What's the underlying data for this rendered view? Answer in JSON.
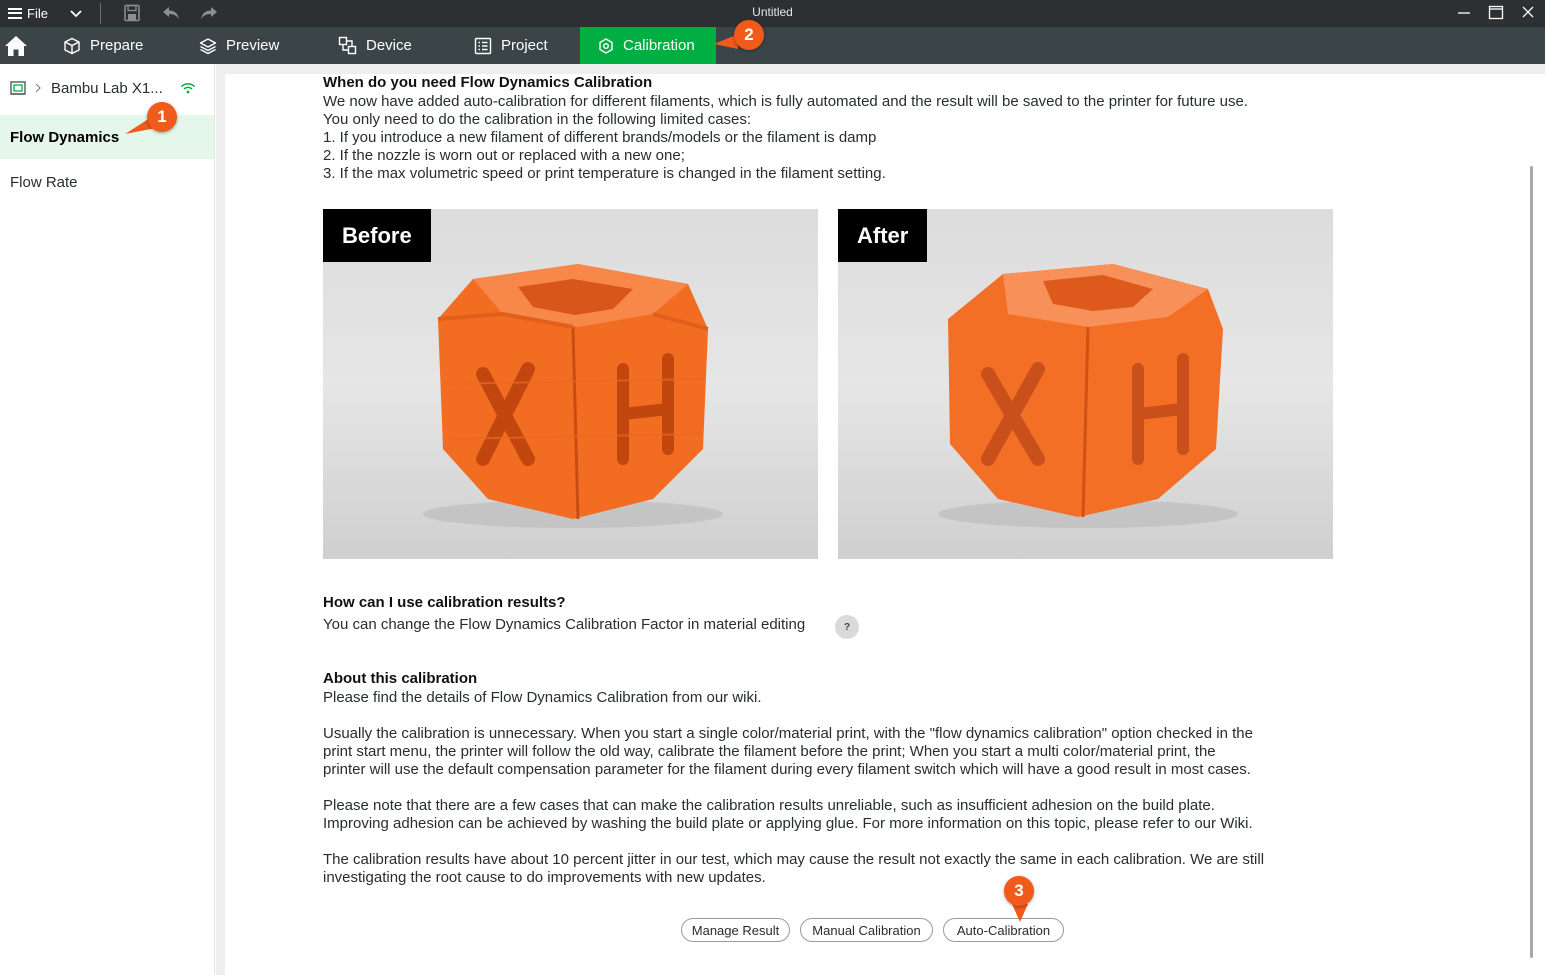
{
  "titlebar": {
    "file_label": "File",
    "window_title": "Untitled"
  },
  "menubar": {
    "tabs": [
      {
        "label": "Prepare",
        "icon": "cube-icon"
      },
      {
        "label": "Preview",
        "icon": "layers-icon"
      },
      {
        "label": "Device",
        "icon": "device-icon"
      },
      {
        "label": "Project",
        "icon": "project-icon"
      },
      {
        "label": "Calibration",
        "icon": "calibration-icon",
        "active": true
      }
    ]
  },
  "sidebar": {
    "printer_name": "Bambu Lab X1...",
    "items": [
      {
        "label": "Flow Dynamics",
        "active": true
      },
      {
        "label": "Flow Rate",
        "active": false
      }
    ]
  },
  "content": {
    "section1": {
      "heading": "When do you need Flow Dynamics Calibration",
      "lines": [
        "We now have added auto-calibration for different filaments, which is fully automated and the result will be saved to the printer for future use.",
        "You only need to do the calibration in the following limited cases:",
        "1. If you introduce a new filament of different brands/models or the filament is damp",
        "2. If the nozzle is worn out or replaced with a new one;",
        "3. If the max volumetric speed or print temperature is changed in the filament setting."
      ]
    },
    "images": {
      "before_label": "Before",
      "after_label": "After"
    },
    "section2": {
      "heading": "How can I use calibration results?",
      "text": "You can change the Flow Dynamics Calibration Factor in material editing",
      "help_glyph": "?"
    },
    "section3": {
      "heading": "About this calibration",
      "line1": "Please find the details of Flow Dynamics Calibration from our wiki.",
      "para1": [
        "Usually the calibration is unnecessary. When you start a single color/material print, with the \"flow dynamics calibration\" option checked in the",
        "print start menu, the printer will follow the old way, calibrate the filament before the print; When you start a multi color/material print, the",
        "printer will use the default compensation parameter for the filament during every filament switch which will have a good result in most cases."
      ],
      "para2": [
        "Please note that there are a few cases that can make the calibration results unreliable, such as insufficient adhesion on the build plate.",
        "Improving adhesion can be achieved by washing the build plate or applying glue. For more information on this topic, please refer to our Wiki."
      ],
      "para3": [
        "The calibration results have about 10 percent jitter in our test, which may cause the result not exactly the same in each calibration. We are still",
        "investigating the root cause to do improvements with new updates."
      ]
    },
    "buttons": {
      "manage_result": "Manage Result",
      "manual_calibration": "Manual Calibration",
      "auto_calibration": "Auto-Calibration"
    }
  },
  "callouts": [
    "1",
    "2",
    "3"
  ],
  "colors": {
    "accent_green": "#00ae42",
    "selected_bg": "#e5f7ea",
    "callout_orange": "#f05a1a",
    "titlebar_bg": "#2d3032",
    "menubar_bg": "#3b4446"
  }
}
